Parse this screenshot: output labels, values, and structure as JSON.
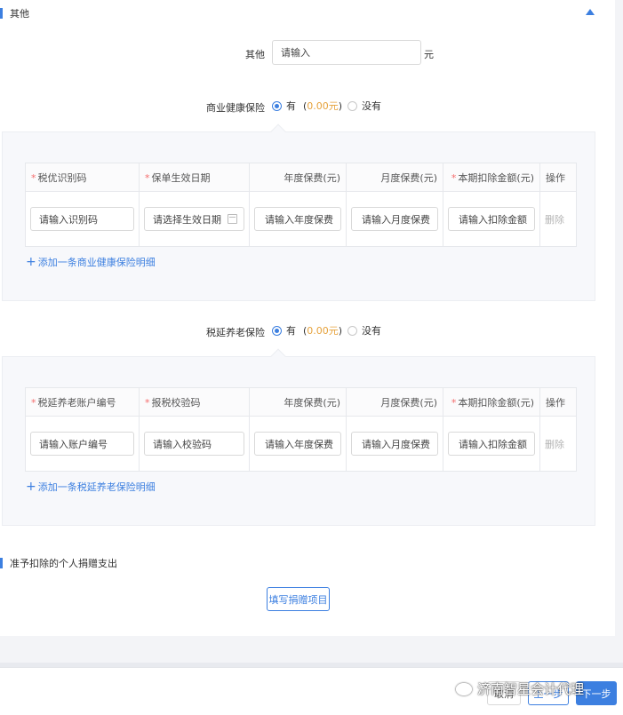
{
  "section_other": {
    "title": "其他",
    "other_label": "其他",
    "other_placeholder": "请输入",
    "other_unit": "元"
  },
  "commercial_health": {
    "label": "商业健康保险",
    "yes_label": "有",
    "amount_open": "(",
    "amount": "0.00元",
    "amount_close": ")",
    "no_label": "没有",
    "selected": "有",
    "headers": [
      "税优识别码",
      "保单生效日期",
      "年度保费(元)",
      "月度保费(元)",
      "本期扣除金额(元)",
      "操作"
    ],
    "row": {
      "code_placeholder": "请输入识别码",
      "date_placeholder": "请选择生效日期",
      "annual_placeholder": "请输入年度保费",
      "monthly_placeholder": "请输入月度保费",
      "deduct_placeholder": "请输入扣除金额",
      "delete_label": "删除"
    },
    "add_label": "添加一条商业健康保险明细"
  },
  "tax_deferred_pension": {
    "label": "税延养老保险",
    "yes_label": "有",
    "amount_open": "(",
    "amount": "0.00元",
    "amount_close": ")",
    "no_label": "没有",
    "selected": "有",
    "headers": [
      "税延养老账户编号",
      "报税校验码",
      "年度保费(元)",
      "月度保费(元)",
      "本期扣除金额(元)",
      "操作"
    ],
    "row": {
      "account_placeholder": "请输入账户编号",
      "check_placeholder": "请输入校验码",
      "annual_placeholder": "请输入年度保费",
      "monthly_placeholder": "请输入月度保费",
      "deduct_placeholder": "请输入扣除金额",
      "delete_label": "删除"
    },
    "add_label": "添加一条税延养老保险明细"
  },
  "donation": {
    "title": "准予扣除的个人捐赠支出",
    "fill_button": "填写捐赠项目"
  },
  "footer": {
    "cancel": "取消",
    "prev": "上一步",
    "next": "下一步"
  },
  "watermark": {
    "text": "济南智星会计代理"
  },
  "colors": {
    "accent": "#3c7fe0",
    "amount": "#e6a23c",
    "required": "#f56c6c"
  }
}
